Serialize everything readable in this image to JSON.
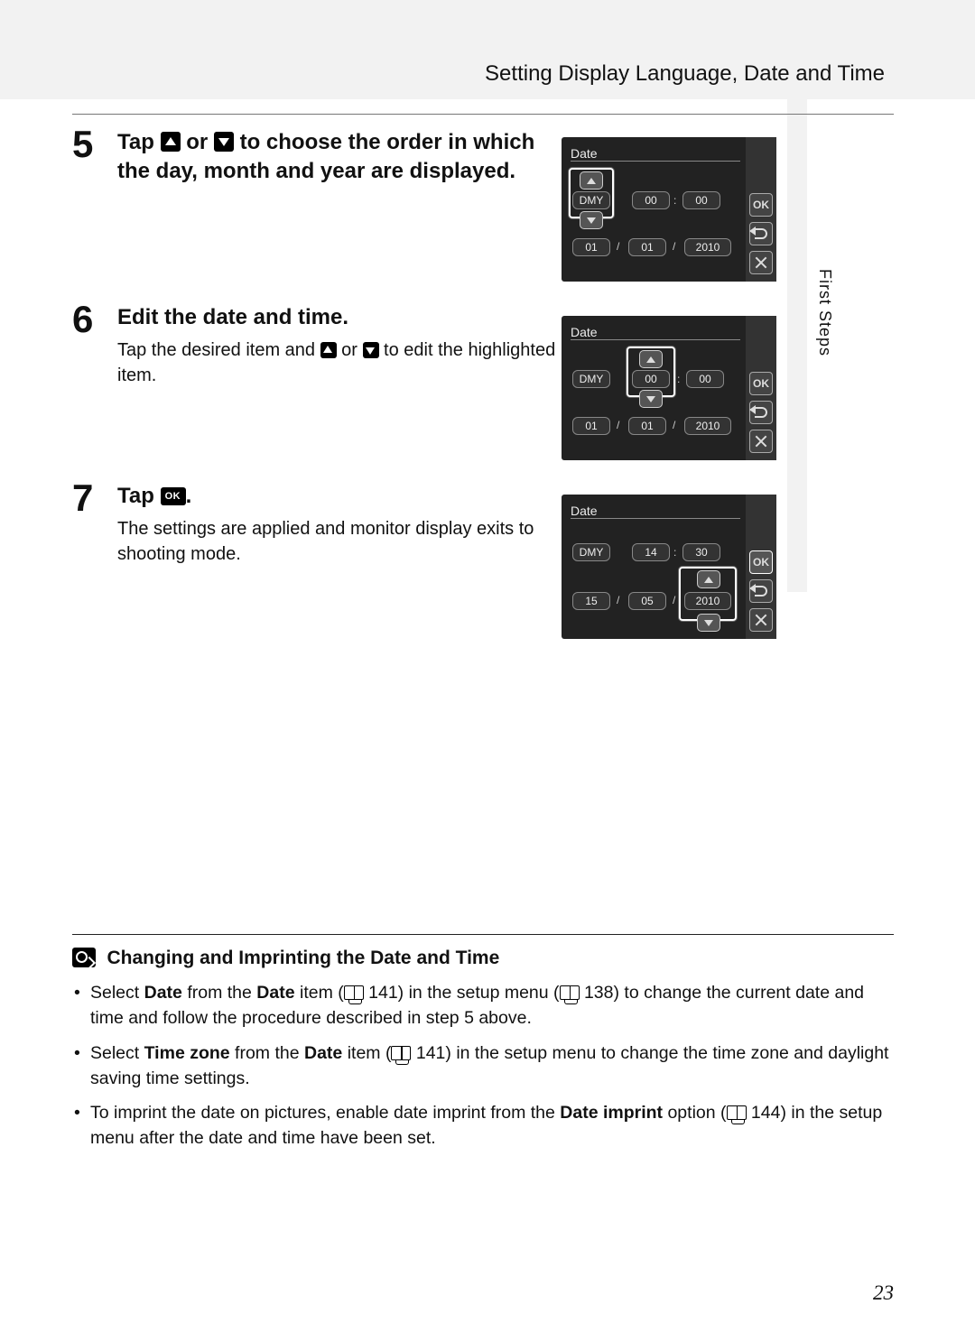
{
  "header": {
    "title": "Setting Display Language, Date and Time"
  },
  "side_tab": "First Steps",
  "page_number": "23",
  "steps": {
    "s5": {
      "num": "5",
      "title_a": "Tap ",
      "title_b": " or ",
      "title_c": " to choose the order in which the day, month and year are displayed."
    },
    "s6": {
      "num": "6",
      "title": "Edit the date and time.",
      "desc_a": "Tap the desired item and ",
      "desc_b": " or ",
      "desc_c": " to edit the highlighted item."
    },
    "s7": {
      "num": "7",
      "title_a": "Tap ",
      "title_b": ".",
      "desc": "The settings are applied and monitor display exits to shooting mode."
    }
  },
  "lcd_common": {
    "title": "Date",
    "ok": "OK",
    "dmy": "DMY",
    "colon": ":",
    "slash": "/"
  },
  "lcd1": {
    "h": "00",
    "m": "00",
    "d": "01",
    "mo": "01",
    "y": "2010"
  },
  "lcd2": {
    "h": "00",
    "m": "00",
    "d": "01",
    "mo": "01",
    "y": "2010"
  },
  "lcd3": {
    "h": "14",
    "m": "30",
    "d": "15",
    "mo": "05",
    "y": "2010"
  },
  "notes": {
    "title": "Changing and Imprinting the Date and Time",
    "b1_a": "Select ",
    "b1_b": "Date",
    "b1_c": " from the ",
    "b1_d": "Date",
    "b1_e": " item (",
    "b1_f": " 141) in the setup menu (",
    "b1_g": " 138) to change the current date and time and follow the procedure described in step 5 above.",
    "b2_a": "Select ",
    "b2_b": "Time zone",
    "b2_c": " from the ",
    "b2_d": "Date",
    "b2_e": " item (",
    "b2_f": " 141) in the setup menu to change the time zone and daylight saving time settings.",
    "b3_a": "To imprint the date on pictures, enable date imprint from the ",
    "b3_b": "Date imprint",
    "b3_c": " option (",
    "b3_d": " 144) in the setup menu after the date and time have been set."
  }
}
